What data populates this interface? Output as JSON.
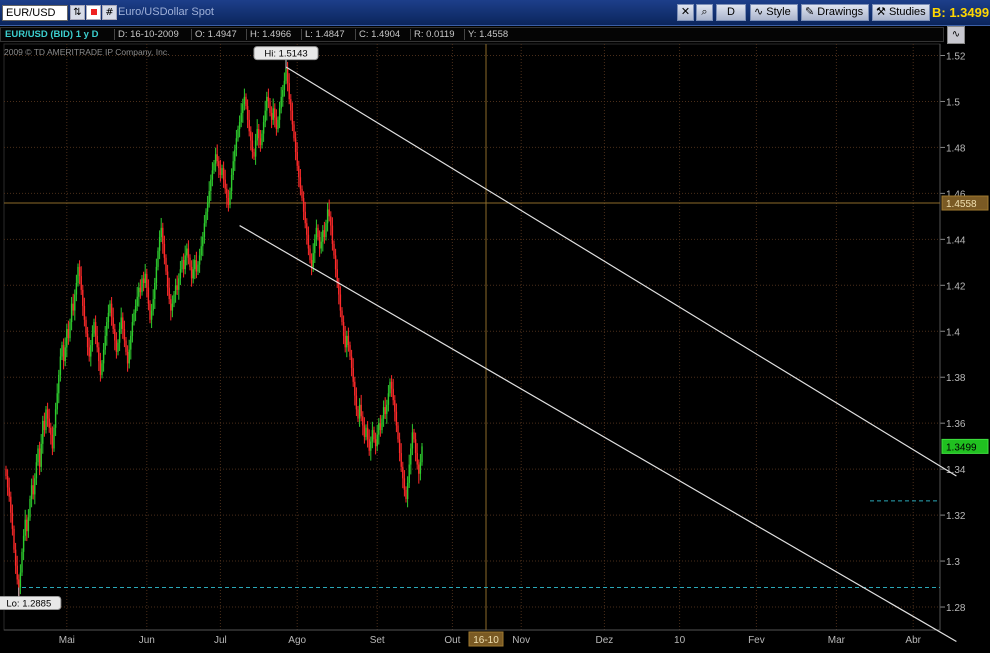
{
  "toolbar": {
    "symbol": "EUR/USD",
    "description": "Euro/USDollar Spot",
    "period_button": "D",
    "style_label": "Style",
    "drawings_label": "Drawings",
    "studies_label": "Studies",
    "bid_label": "B: 1.3499"
  },
  "info_bar": {
    "symbol_period": "EUR/USD (BID) 1 y D",
    "date": "D: 16-10-2009",
    "open": "O: 1.4947",
    "high": "H: 1.4966",
    "low": "L: 1.4847",
    "close": "C: 1.4904",
    "range": "R: 0.0119",
    "y": "Y: 1.4558"
  },
  "copyright": "2009 © TD AMERITRADE IP Company, Inc.",
  "colors": {
    "background": "#000000",
    "up_candle": "#2ecc2e",
    "down_candle": "#ff2a2a",
    "grid": "#4a2e1a",
    "crosshair": "#8b6a2a",
    "channel": "#e0e0e0",
    "dashed_level": "#2aa8b8"
  },
  "chart_data": {
    "type": "candlestick",
    "series": [
      {
        "name": "EUR/USD"
      }
    ],
    "ylim": [
      1.27,
      1.525
    ],
    "y_ticks": [
      "1.52",
      "1.5",
      "1.48",
      "1.46",
      "1.44",
      "1.42",
      "1.4",
      "1.38",
      "1.36",
      "1.34",
      "1.32",
      "1.3",
      "1.28"
    ],
    "x_ticks": [
      "Mai",
      "Jun",
      "Jul",
      "Ago",
      "Set",
      "Out",
      "Nov",
      "Dez",
      "10",
      "Fev",
      "Mar",
      "Abr"
    ],
    "x_ticks_index": [
      38,
      88,
      134,
      182,
      232,
      279,
      322,
      374,
      421,
      469,
      519,
      567
    ],
    "close": [
      1.337,
      1.332,
      1.328,
      1.321,
      1.314,
      1.305,
      1.298,
      1.292,
      1.2885,
      1.295,
      1.304,
      1.311,
      1.318,
      1.313,
      1.319,
      1.327,
      1.333,
      1.329,
      1.336,
      1.343,
      1.349,
      1.341,
      1.351,
      1.361,
      1.357,
      1.366,
      1.362,
      1.358,
      1.355,
      1.349,
      1.358,
      1.366,
      1.373,
      1.381,
      1.389,
      1.394,
      1.387,
      1.393,
      1.401,
      1.397,
      1.404,
      1.412,
      1.409,
      1.416,
      1.421,
      1.428,
      1.424,
      1.418,
      1.411,
      1.405,
      1.399,
      1.393,
      1.389,
      1.394,
      1.399,
      1.404,
      1.398,
      1.393,
      1.387,
      1.381,
      1.386,
      1.392,
      1.398,
      1.404,
      1.408,
      1.412,
      1.406,
      1.401,
      1.396,
      1.391,
      1.395,
      1.401,
      1.406,
      1.401,
      1.396,
      1.391,
      1.386,
      1.392,
      1.398,
      1.404,
      1.408,
      1.411,
      1.415,
      1.419,
      1.417,
      1.423,
      1.421,
      1.425,
      1.419,
      1.412,
      1.405,
      1.409,
      1.414,
      1.421,
      1.428,
      1.435,
      1.441,
      1.445,
      1.438,
      1.432,
      1.426,
      1.419,
      1.414,
      1.409,
      1.412,
      1.416,
      1.42,
      1.418,
      1.423,
      1.427,
      1.431,
      1.427,
      1.433,
      1.436,
      1.432,
      1.428,
      1.423,
      1.427,
      1.431,
      1.426,
      1.429,
      1.433,
      1.437,
      1.441,
      1.447,
      1.452,
      1.456,
      1.461,
      1.466,
      1.47,
      1.473,
      1.477,
      1.474,
      1.471,
      1.468,
      1.471,
      1.466,
      1.462,
      1.458,
      1.455,
      1.461,
      1.468,
      1.474,
      1.479,
      1.484,
      1.488,
      1.491,
      1.495,
      1.499,
      1.502,
      1.498,
      1.492,
      1.487,
      1.483,
      1.478,
      1.476,
      1.483,
      1.488,
      1.484,
      1.481,
      1.486,
      1.491,
      1.496,
      1.502,
      1.5,
      1.495,
      1.492,
      1.497,
      1.493,
      1.488,
      1.492,
      1.497,
      1.502,
      1.505,
      1.509,
      1.5143,
      1.508,
      1.501,
      1.496,
      1.49,
      1.484,
      1.478,
      1.472,
      1.467,
      1.462,
      1.458,
      1.452,
      1.447,
      1.442,
      1.436,
      1.431,
      1.428,
      1.434,
      1.44,
      1.445,
      1.441,
      1.436,
      1.439,
      1.444,
      1.441,
      1.447,
      1.453,
      1.45,
      1.446,
      1.438,
      1.433,
      1.427,
      1.421,
      1.416,
      1.409,
      1.404,
      1.398,
      1.393,
      1.398,
      1.394,
      1.389,
      1.384,
      1.378,
      1.372,
      1.366,
      1.362,
      1.368,
      1.363,
      1.359,
      1.354,
      1.358,
      1.353,
      1.348,
      1.352,
      1.357,
      1.353,
      1.35,
      1.355,
      1.36,
      1.357,
      1.362,
      1.367,
      1.364,
      1.368,
      1.373,
      1.378,
      1.375,
      1.37,
      1.365,
      1.359,
      1.353,
      1.347,
      1.341,
      1.336,
      1.331,
      1.327,
      1.334,
      1.342,
      1.349,
      1.356,
      1.353,
      1.347,
      1.342,
      1.338,
      1.343,
      1.3499
    ],
    "annotations": [
      {
        "label": "Hi: 1.5143",
        "index": 175,
        "value": 1.5143
      },
      {
        "label": "Lo: 1.2885",
        "index": 8,
        "value": 1.2885
      }
    ],
    "price_labels": [
      {
        "label": "1.4558",
        "value": 1.4558
      },
      {
        "label": "1.3499",
        "value": 1.3499
      }
    ],
    "crosshair_date_label": "16-10",
    "crosshair_index": 300,
    "dashed_levels": [
      1.2885,
      1.3262
    ],
    "channel_lines": [
      {
        "from": [
          175,
          1.515
        ],
        "to": [
          594,
          1.337
        ]
      },
      {
        "from": [
          146,
          1.446
        ],
        "to": [
          594,
          1.265
        ]
      }
    ],
    "grid": true
  }
}
